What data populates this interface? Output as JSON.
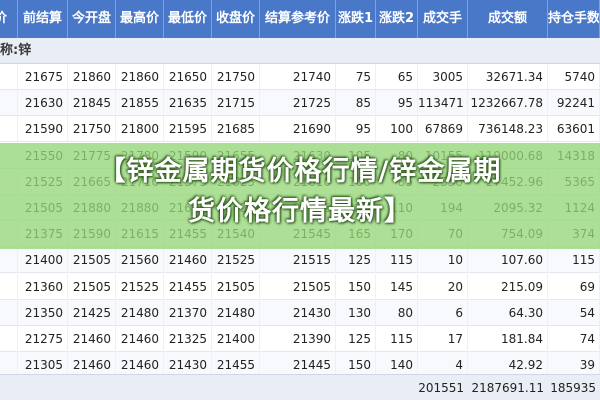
{
  "table": {
    "headers": [
      "价",
      "前结算",
      "今开盘",
      "最高价",
      "最低价",
      "收盘价",
      "结算参考价",
      "涨跌1",
      "涨跌2",
      "成交手",
      "成交额",
      "持仓手数"
    ],
    "group_label": "称:锌",
    "rows": [
      [
        "",
        "21675",
        "21860",
        "21860",
        "21650",
        "21750",
        "21740",
        "75",
        "65",
        "3005",
        "32671.34",
        "5740"
      ],
      [
        "",
        "21630",
        "21845",
        "21855",
        "21635",
        "21715",
        "21725",
        "85",
        "95",
        "113471",
        "1232667.78",
        "92241"
      ],
      [
        "",
        "21590",
        "21750",
        "21800",
        "21595",
        "21685",
        "21690",
        "95",
        "100",
        "67869",
        "736148.23",
        "63601"
      ],
      [
        "",
        "21550",
        "21775",
        "21780",
        "21590",
        "21655",
        "21630",
        "105",
        "80",
        "10155",
        "119000.68",
        "14318"
      ],
      [
        "",
        "21525",
        "21665",
        "21710",
        "21575",
        "21625",
        "21610",
        "100",
        "85",
        "2530",
        "27452.96",
        "5365"
      ],
      [
        "",
        "21505",
        "21880",
        "21880",
        "21650",
        "21650",
        "21615",
        "145",
        "110",
        "194",
        "2095.32",
        "1124"
      ],
      [
        "",
        "21375",
        "21590",
        "21615",
        "21455",
        "21540",
        "21545",
        "165",
        "170",
        "70",
        "754.09",
        "374"
      ],
      [
        "",
        "21400",
        "21505",
        "21560",
        "21460",
        "21525",
        "21515",
        "125",
        "115",
        "10",
        "107.60",
        "115"
      ],
      [
        "",
        "21360",
        "21505",
        "21525",
        "21455",
        "21505",
        "21505",
        "150",
        "145",
        "20",
        "215.09",
        "69"
      ],
      [
        "",
        "21350",
        "21425",
        "21480",
        "21370",
        "21480",
        "21430",
        "130",
        "80",
        "6",
        "64.30",
        "54"
      ],
      [
        "",
        "21275",
        "21460",
        "21460",
        "21325",
        "21400",
        "21390",
        "125",
        "115",
        "17",
        "181.84",
        "74"
      ],
      [
        "",
        "21305",
        "21460",
        "21460",
        "21430",
        "21455",
        "21445",
        "150",
        "140",
        "4",
        "42.92",
        "39"
      ]
    ],
    "total": [
      "",
      "",
      "",
      "",
      "",
      "",
      "",
      "",
      "",
      "201551",
      "2187691.11",
      "185935"
    ]
  },
  "overlay": {
    "line1": "【锌金属期货价格行情/锌金属期",
    "line2": "货价格行情最新】",
    "background_color": "#96d778"
  },
  "colors": {
    "header_bg": "#4a78c8",
    "header_text": "#ffffff",
    "group_bg": "#e9edf5"
  }
}
